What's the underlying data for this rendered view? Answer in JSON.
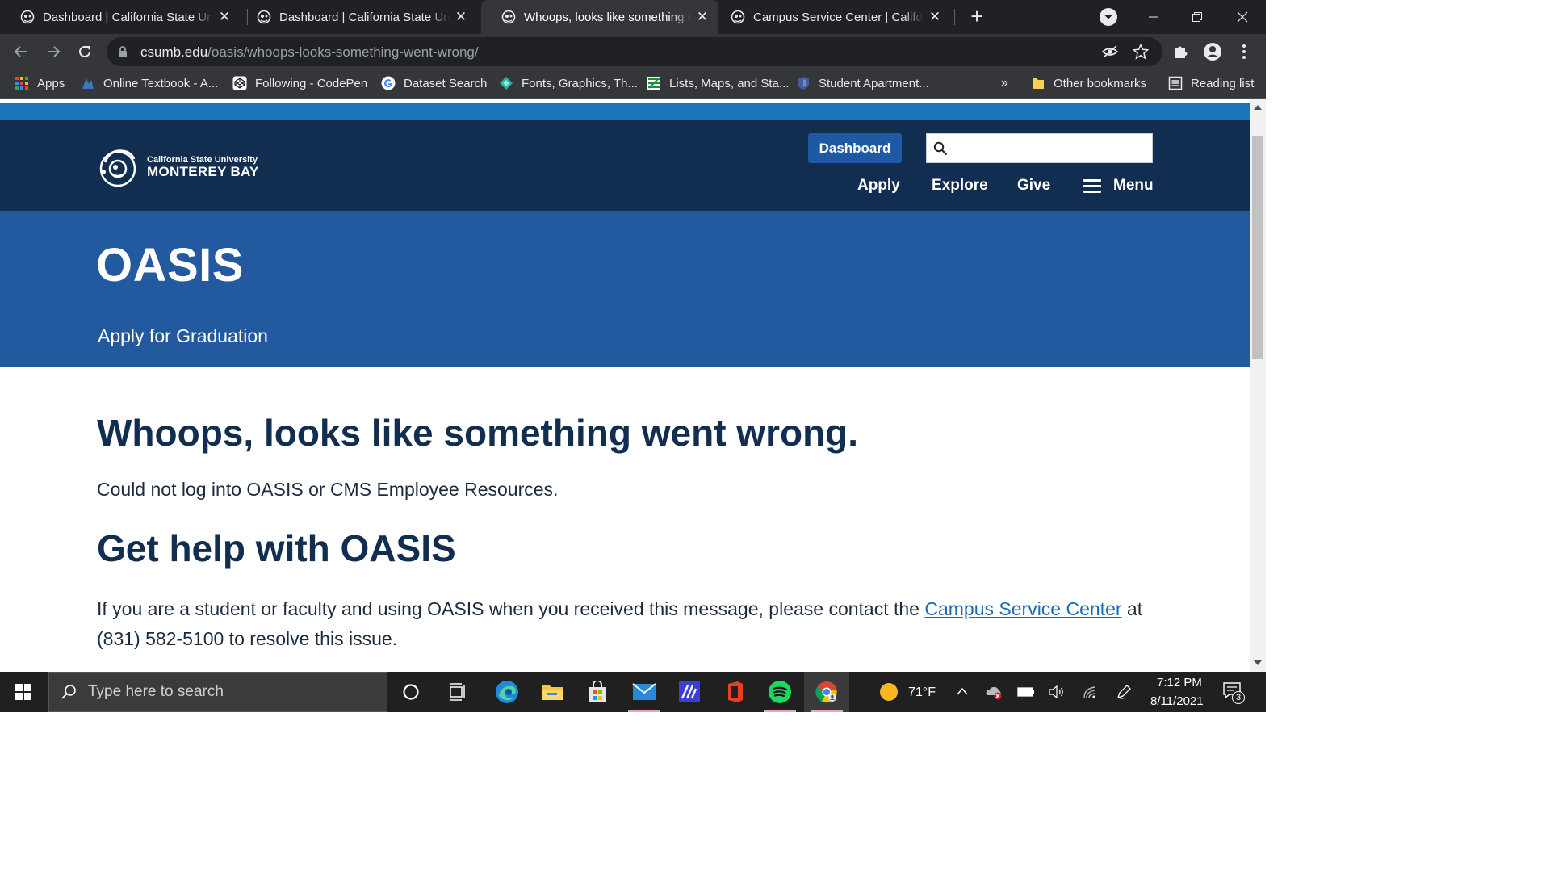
{
  "browser": {
    "tabs": [
      {
        "title": "Dashboard | California State University",
        "active": false
      },
      {
        "title": "Dashboard | California State University",
        "active": false
      },
      {
        "title": "Whoops, looks like something went wrong",
        "active": true
      },
      {
        "title": "Campus Service Center | California State University",
        "active": false
      }
    ],
    "url_host": "csumb.edu",
    "url_path": "/oasis/whoops-looks-something-went-wrong/",
    "bookmarks": [
      {
        "label": "Apps",
        "icon": "apps-grid-icon"
      },
      {
        "label": "Online Textbook - A...",
        "icon": "textbook-icon"
      },
      {
        "label": "Following - CodePen",
        "icon": "codepen-icon"
      },
      {
        "label": "Dataset Search",
        "icon": "google-icon"
      },
      {
        "label": "Fonts, Graphics, Th...",
        "icon": "fonts-icon"
      },
      {
        "label": "Lists, Maps, and Sta...",
        "icon": "sheets-icon"
      },
      {
        "label": "Student Apartment...",
        "icon": "shield-icon"
      }
    ],
    "bookmarks_overflow": "»",
    "other_bookmarks": "Other bookmarks",
    "reading_list": "Reading list"
  },
  "site": {
    "logo_line1": "California State University",
    "logo_line2": "MONTEREY BAY",
    "dashboard_button": "Dashboard",
    "search_placeholder": "",
    "nav": [
      "Apply",
      "Explore",
      "Give"
    ],
    "menu_label": "Menu",
    "hero_title": "OASIS",
    "hero_link": "Apply for Graduation"
  },
  "content": {
    "heading": "Whoops, looks like something went wrong.",
    "error_text": "Could not log into OASIS or CMS Employee Resources.",
    "help_heading": "Get help with OASIS",
    "help_text_before": "If you are a student or faculty and using OASIS when you received this message, please contact the ",
    "help_link": "Campus Service Center",
    "help_text_after": " at (831) 582-5100 to resolve this issue."
  },
  "taskbar": {
    "search_placeholder": "Type here to search",
    "weather": "71°F",
    "time": "7:12 PM",
    "date": "8/11/2021",
    "notifications": "3"
  },
  "colors": {
    "header_navy": "#112e51",
    "hero_blue": "#22599f",
    "top_stripe": "#1b75bb",
    "dashboard_button": "#1d5aa3",
    "link": "#1b6cb5"
  }
}
